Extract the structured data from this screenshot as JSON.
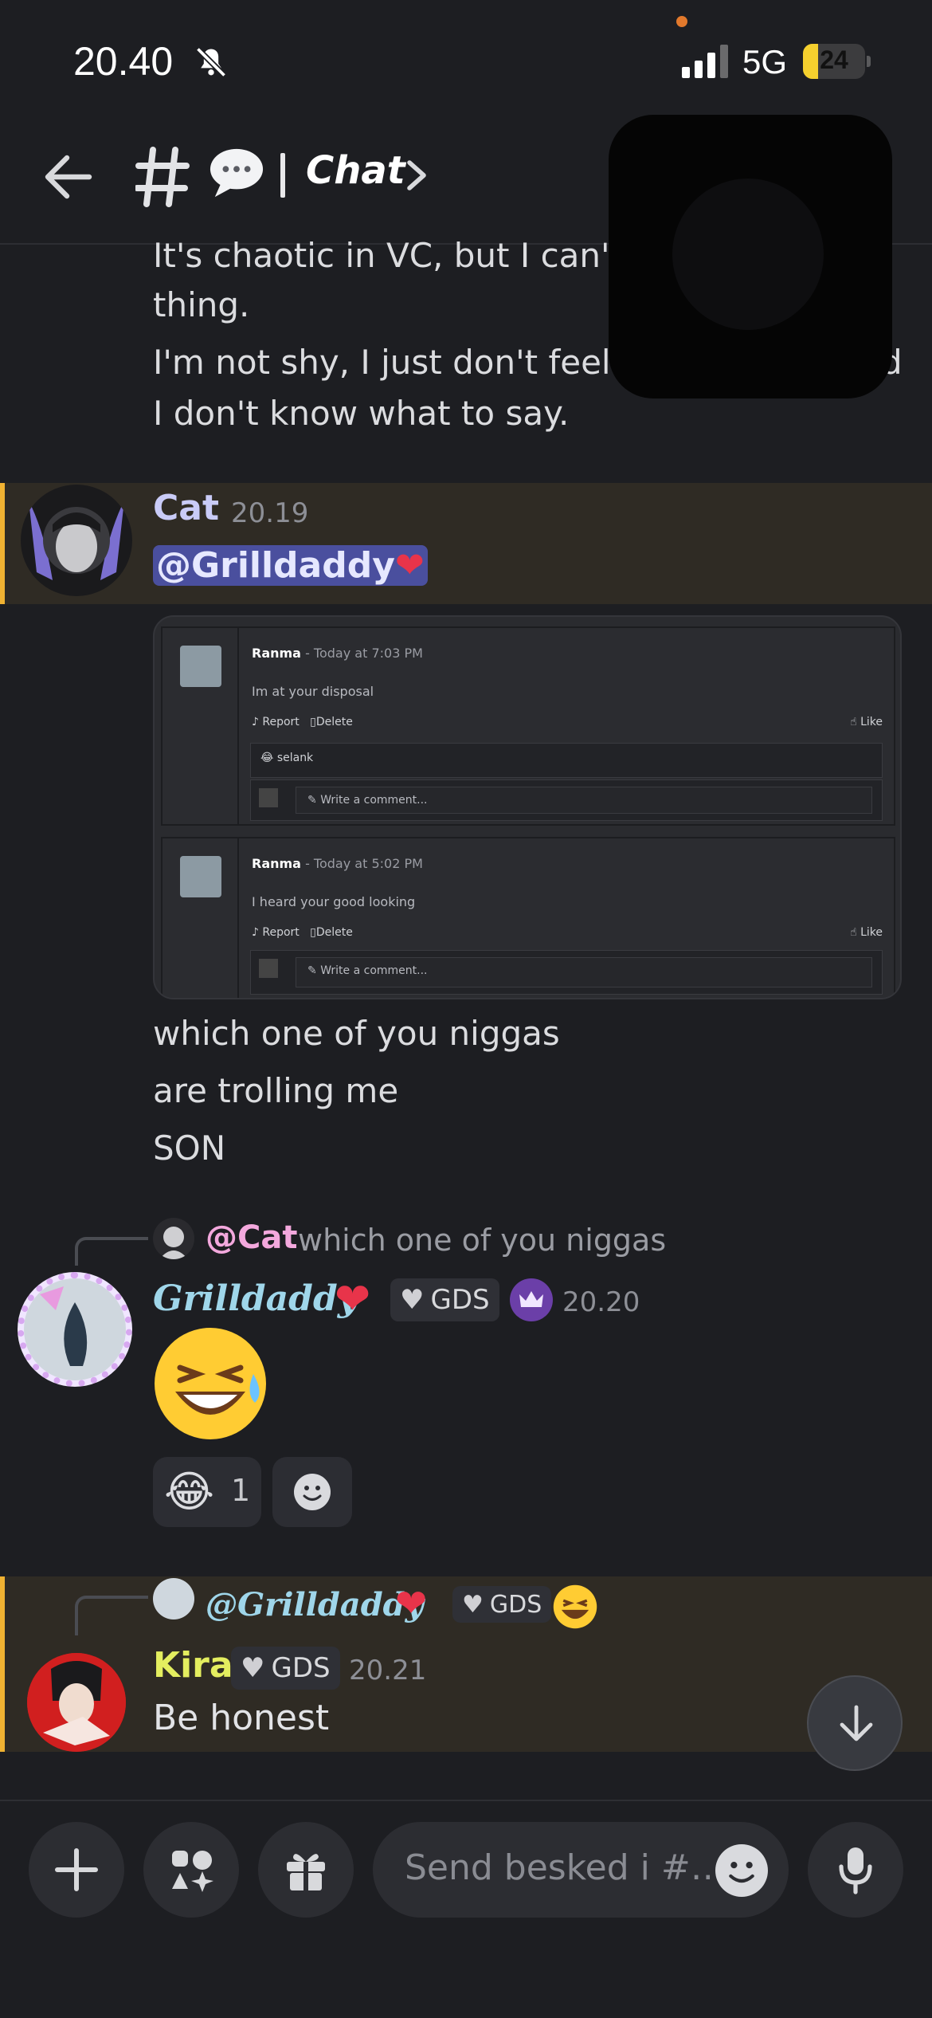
{
  "status_bar": {
    "time": "20.40",
    "network": "5G",
    "battery": "24"
  },
  "header": {
    "channel_name": "Chat"
  },
  "top_messages": [
    "It's chaotic in VC, but I can't",
    "thing.",
    "I'm not shy, I just don't feel lik",
    "d",
    "I don't know what to say."
  ],
  "cat_message": {
    "username": "Cat",
    "time": "20.19",
    "mention": "@Grilldaddy",
    "screenshot": {
      "posts": [
        {
          "name": "Ranma",
          "date": " - Today at 7:03 PM",
          "text": "Im at your disposal",
          "report": "Report",
          "delete": "Delete",
          "like": "Like",
          "comment_name": "selank",
          "comment_placeholder": "Write a comment..."
        },
        {
          "name": "Ranma",
          "date": " - Today at 5:02 PM",
          "text": "I heard your good looking",
          "report": "Report",
          "delete": "Delete",
          "like": "Like",
          "comment_placeholder": "Write a comment..."
        }
      ]
    },
    "followups": [
      "which one of you niggas",
      "are trolling me",
      "SON"
    ]
  },
  "grill_message": {
    "reply_mention": "@Cat",
    "reply_text": "which one of you niggas",
    "username": "Grilldaddy",
    "tag": "GDS",
    "time": "20.20",
    "reaction_count": "1"
  },
  "kira_message": {
    "reply_mention": "@Grilldaddy",
    "reply_tag": "GDS",
    "username": "Kira",
    "tag": "GDS",
    "time": "20.21",
    "text": "Be honest"
  },
  "composer": {
    "placeholder": "Send besked i #…"
  },
  "colors": {
    "accent": "#f0b232",
    "mention_bg": "#4a4f9e",
    "cat_name": "#c9cbf7",
    "kira_name": "#e4ee5f",
    "grill_name": "#9fd6ea",
    "mention_pink": "#f3a8dd"
  }
}
